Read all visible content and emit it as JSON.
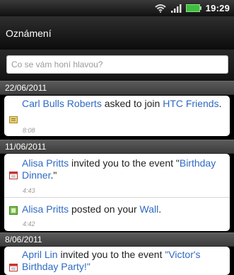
{
  "status_bar": {
    "time": "19:29",
    "icons": [
      "wifi-icon",
      "signal-icon",
      "battery-icon"
    ]
  },
  "header": {
    "title": "Oznámení"
  },
  "search": {
    "placeholder": "Co se vám honí hlavou?"
  },
  "sections": [
    {
      "date": "22/06/2011",
      "items": [
        {
          "icon": "friend-request-icon",
          "parts": [
            "Carl Bulls Roberts",
            " asked to join ",
            "HTC Friends",
            "."
          ],
          "time": "8:08"
        }
      ]
    },
    {
      "date": "11/06/2011",
      "items": [
        {
          "icon": "event-icon",
          "parts": [
            "Alisa Pritts",
            " invited you to the event \"",
            "Birthday Dinner",
            ".\""
          ],
          "time": "4:43"
        },
        {
          "icon": "wall-post-icon",
          "parts": [
            "Alisa Pritts",
            " posted on your ",
            "Wall",
            "."
          ],
          "time": "4:42"
        }
      ]
    },
    {
      "date": "8/06/2011",
      "items": [
        {
          "icon": "event-icon",
          "parts": [
            "April Lin",
            " invited you to the event ",
            "\"Victor's Birthday Party!\""
          ],
          "time": ""
        }
      ]
    }
  ],
  "colors": {
    "link": "#2f6ac3",
    "section_header": "#4a4a4a",
    "card": "#ffffff"
  }
}
